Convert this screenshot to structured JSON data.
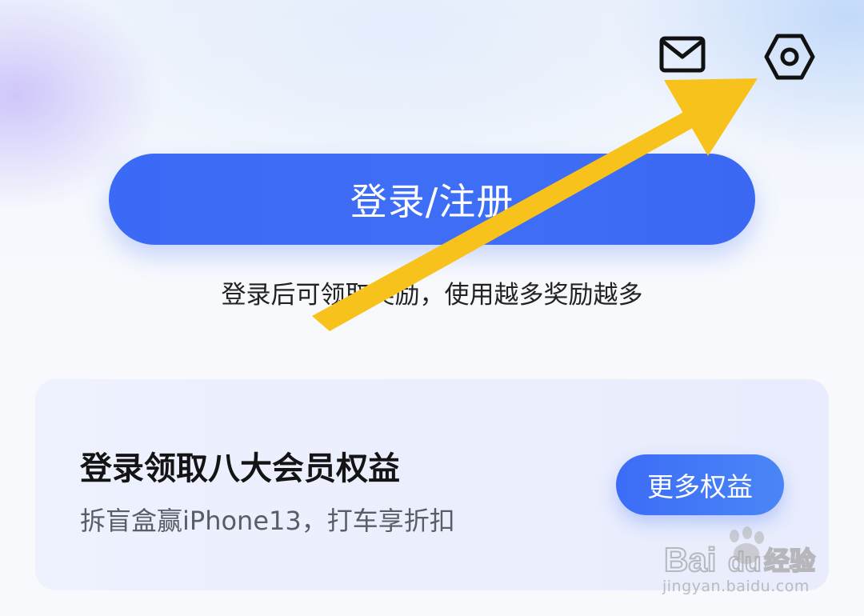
{
  "header": {
    "mail_icon": "mail-icon",
    "settings_icon": "settings-icon"
  },
  "login": {
    "button_label": "登录/注册",
    "hint": "登录后可领取奖励，使用越多奖励越多"
  },
  "benefits_card": {
    "title": "登录领取八大会员权益",
    "subtitle": "拆盲盒赢iPhone13，打车享折扣",
    "more_button": "更多权益"
  },
  "watermark": {
    "brand": "Bai经验",
    "url": "jingyan.baidu.com"
  },
  "colors": {
    "primary": "#3b6af6",
    "arrow": "#f8c21c",
    "card_bg": "#eceffd"
  }
}
